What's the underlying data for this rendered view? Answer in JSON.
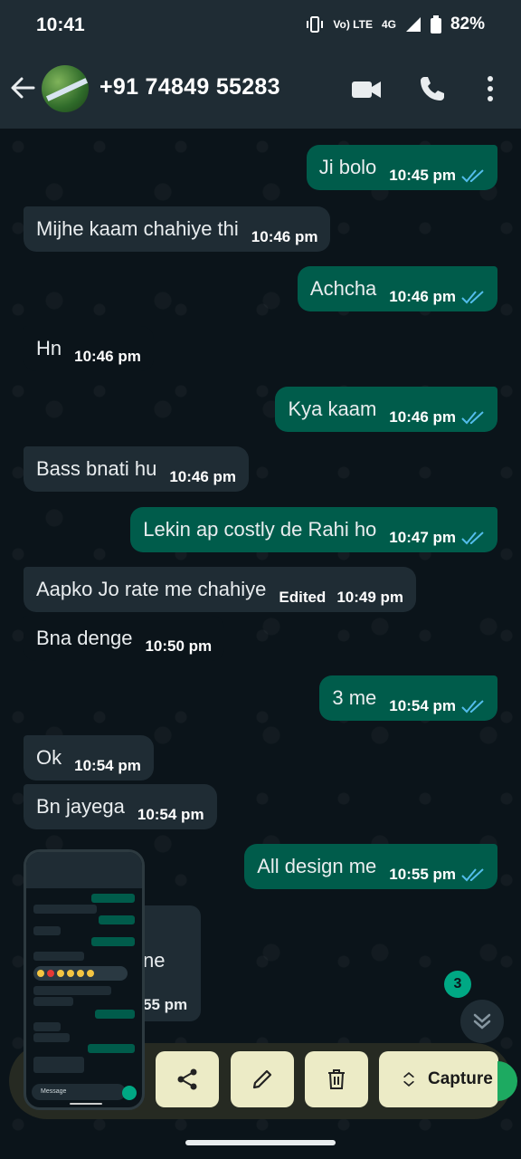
{
  "status_bar": {
    "time": "10:41",
    "network_label": "Vo) LTE",
    "network_type": "4G",
    "battery": "82%"
  },
  "header": {
    "contact_name": "+91 74849 55283",
    "icons": [
      "back-arrow-icon",
      "video-call-icon",
      "voice-call-icon",
      "more-options-icon"
    ]
  },
  "messages": [
    {
      "direction": "out",
      "text": "Ji bolo",
      "time": "10:45 pm",
      "read": true
    },
    {
      "direction": "in",
      "text": "Mijhe kaam chahiye thi",
      "time": "10:46 pm"
    },
    {
      "direction": "out",
      "text": "Achcha",
      "time": "10:46 pm",
      "read": true
    },
    {
      "direction": "in",
      "text": "Hn",
      "time": "10:46 pm"
    },
    {
      "direction": "out",
      "text": "Kya kaam",
      "time": "10:46 pm",
      "read": true
    },
    {
      "direction": "in",
      "text": "Bass bnati hu",
      "time": "10:46 pm"
    },
    {
      "direction": "out",
      "text": "Lekin ap costly de Rahi ho",
      "time": "10:47 pm",
      "read": true
    },
    {
      "direction": "in",
      "text": "Aapko Jo rate me chahiye",
      "time": "10:49 pm",
      "edited": "Edited"
    },
    {
      "direction": "in",
      "text": "Bna denge",
      "time": "10:50 pm"
    },
    {
      "direction": "out",
      "text": "3 me",
      "time": "10:54 pm",
      "read": true
    },
    {
      "direction": "in",
      "text": "Ok",
      "time": "10:54 pm"
    },
    {
      "direction": "in",
      "text": "Bn jayega",
      "time": "10:54 pm"
    },
    {
      "direction": "out",
      "text": "All design me",
      "time": "10:55 pm",
      "read": true
    }
  ],
  "partially_hidden_message": {
    "text_fragment": "ne",
    "time_fragment": "55 pm"
  },
  "unread_count": "3",
  "screenshot_toolbar": {
    "buttons": [
      "share-icon",
      "edit-icon",
      "delete-icon"
    ],
    "capture_label": "Capture"
  },
  "thumbnail": {
    "input_placeholder": "Message"
  },
  "colors": {
    "background": "#0b141a",
    "incoming_bubble": "#1f2c34",
    "outgoing_bubble": "#005c4b",
    "read_ticks": "#53bdeb",
    "accent": "#00a884"
  }
}
